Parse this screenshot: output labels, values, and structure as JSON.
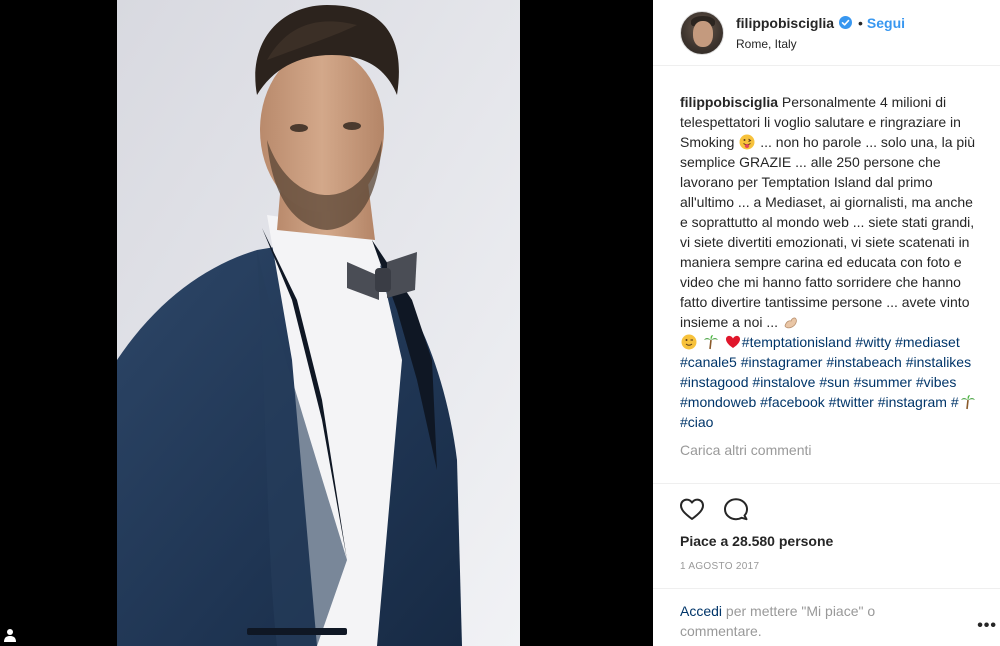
{
  "post": {
    "username": "filippobisciglia",
    "follow_label": "Segui",
    "dot": "•",
    "location": "Rome, Italy"
  },
  "caption": {
    "user": "filippobisciglia",
    "text1": "Personalmente 4 milioni di telespettatori li voglio salutare e ringraziare in Smoking",
    "text2": "... non ho parole ... solo una, la più semplice GRAZIE ... alle 250 persone che lavorano per Temptation Island dal primo all'ultimo ... a Mediaset, ai giornalisti, ma anche e soprattutto al mondo web ... siete stati grandi, vi siete divertiti emozionati, vi siete scatenati in maniera sempre carina ed educata con foto e video che mi hanno fatto sorridere che hanno fatto divertire tantissime persone ... avete vinto insieme a noi ...",
    "hashtags": [
      "#temptationisland",
      "#witty",
      "#mediaset",
      "#canale5",
      "#instagramer",
      "#instabeach",
      "#instalikes",
      "#instagood",
      "#instalove",
      "#sun",
      "#summer",
      "#vibes",
      "#mondoweb",
      "#facebook",
      "#twitter",
      "#instagram",
      "#",
      "#ciao"
    ]
  },
  "load_more": "Carica altri commenti",
  "likes": "Piace a 28.580 persone",
  "date": "1 AGOSTO 2017",
  "login": {
    "link": "Accedi",
    "text": " per mettere \"Mi piace\" o commentare."
  },
  "more_label": "•••",
  "icons": {
    "verified": "verified-badge-icon",
    "like": "heart-outline-icon",
    "comment": "comment-bubble-icon",
    "user": "user-silhouette-icon"
  },
  "colors": {
    "link_blue": "#3897f0",
    "hashtag": "#003569",
    "text": "#262626",
    "muted": "#999999"
  }
}
